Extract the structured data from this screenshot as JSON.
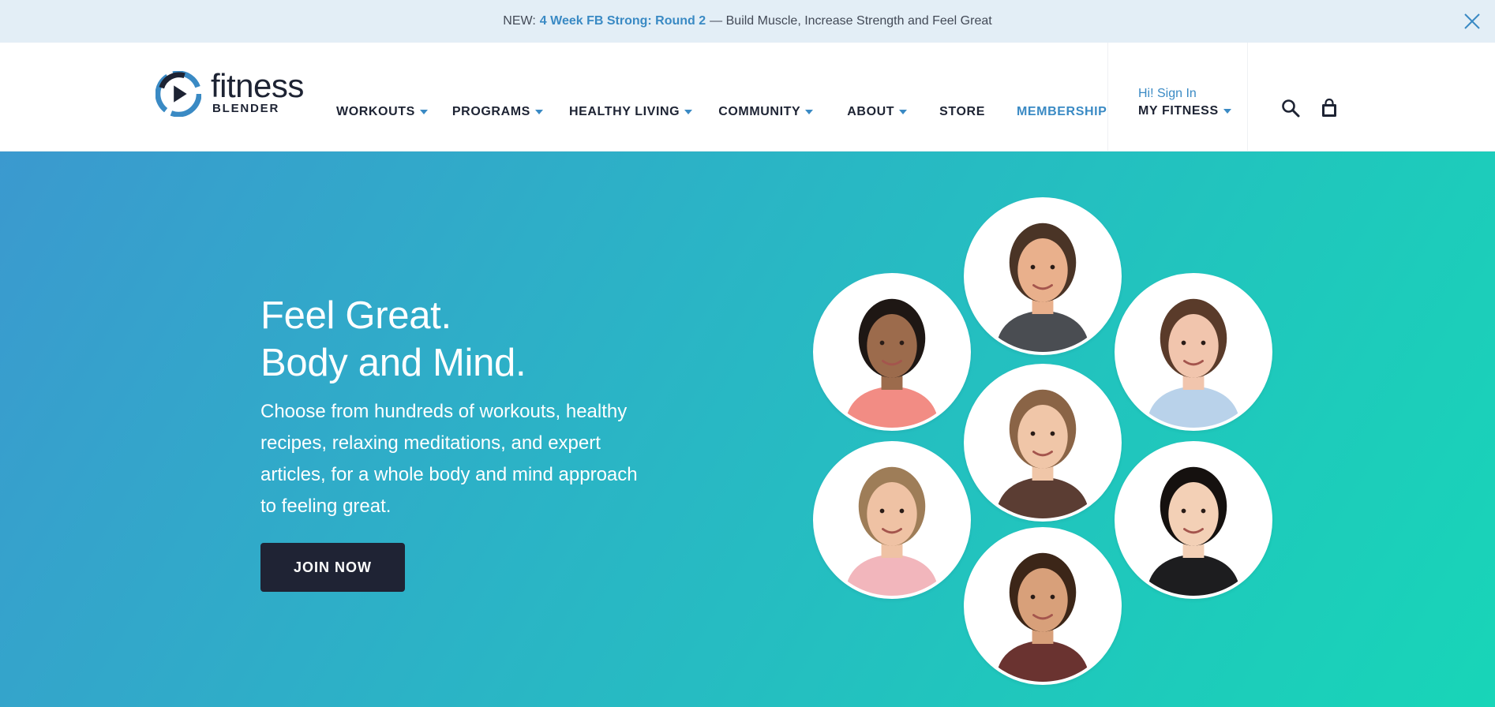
{
  "banner": {
    "prefix": "NEW:",
    "link": "4 Week FB Strong: Round 2",
    "suffix": "— Build Muscle, Increase Strength and Feel Great",
    "close_icon": "close-icon"
  },
  "header": {
    "logo": {
      "word": "fitness",
      "sub": "BLENDER"
    },
    "nav": [
      {
        "label": "WORKOUTS",
        "dropdown": true
      },
      {
        "label": "PROGRAMS",
        "dropdown": true
      },
      {
        "label": "HEALTHY LIVING",
        "dropdown": true
      },
      {
        "label": "COMMUNITY",
        "dropdown": true
      },
      {
        "label": "ABOUT",
        "dropdown": true
      },
      {
        "label": "STORE",
        "dropdown": false
      },
      {
        "label": "MEMBERSHIP",
        "dropdown": false
      }
    ],
    "account": {
      "greeting": "Hi! Sign In",
      "label": "MY FITNESS"
    },
    "icons": [
      "search-icon",
      "shopping-bag-icon"
    ]
  },
  "hero": {
    "headline_line1": "Feel Great.",
    "headline_line2": "Body and Mind.",
    "subtext": "Choose from hundreds of workouts, healthy recipes, relaxing meditations, and expert articles, for a whole body and mind approach to feeling great.",
    "cta": "JOIN NOW",
    "avatars": [
      {
        "skin": "#e9b08c",
        "hair": "#4a3426",
        "shirt": "#4a4d52"
      },
      {
        "skin": "#9c6b4c",
        "hair": "#1e1714",
        "shirt": "#f28c84"
      },
      {
        "skin": "#f1c5ad",
        "hair": "#5a3b2a",
        "shirt": "#b9d2ea"
      },
      {
        "skin": "#f0c6a8",
        "hair": "#8a6446",
        "shirt": "#5b3d33"
      },
      {
        "skin": "#efc2a4",
        "hair": "#9e7d58",
        "shirt": "#f2b6bc"
      },
      {
        "skin": "#f3d0b6",
        "hair": "#15110f",
        "shirt": "#1d1d1f"
      },
      {
        "skin": "#d8a07a",
        "hair": "#3c2618",
        "shirt": "#6a3330"
      }
    ]
  },
  "colors": {
    "brand_blue": "#3a8ac4",
    "dark": "#1d2333",
    "banner_bg": "#e3eef6",
    "hero_gradient_start": "#3b99cf",
    "hero_gradient_end": "#18d5b8",
    "button_bg": "#1f2334"
  }
}
